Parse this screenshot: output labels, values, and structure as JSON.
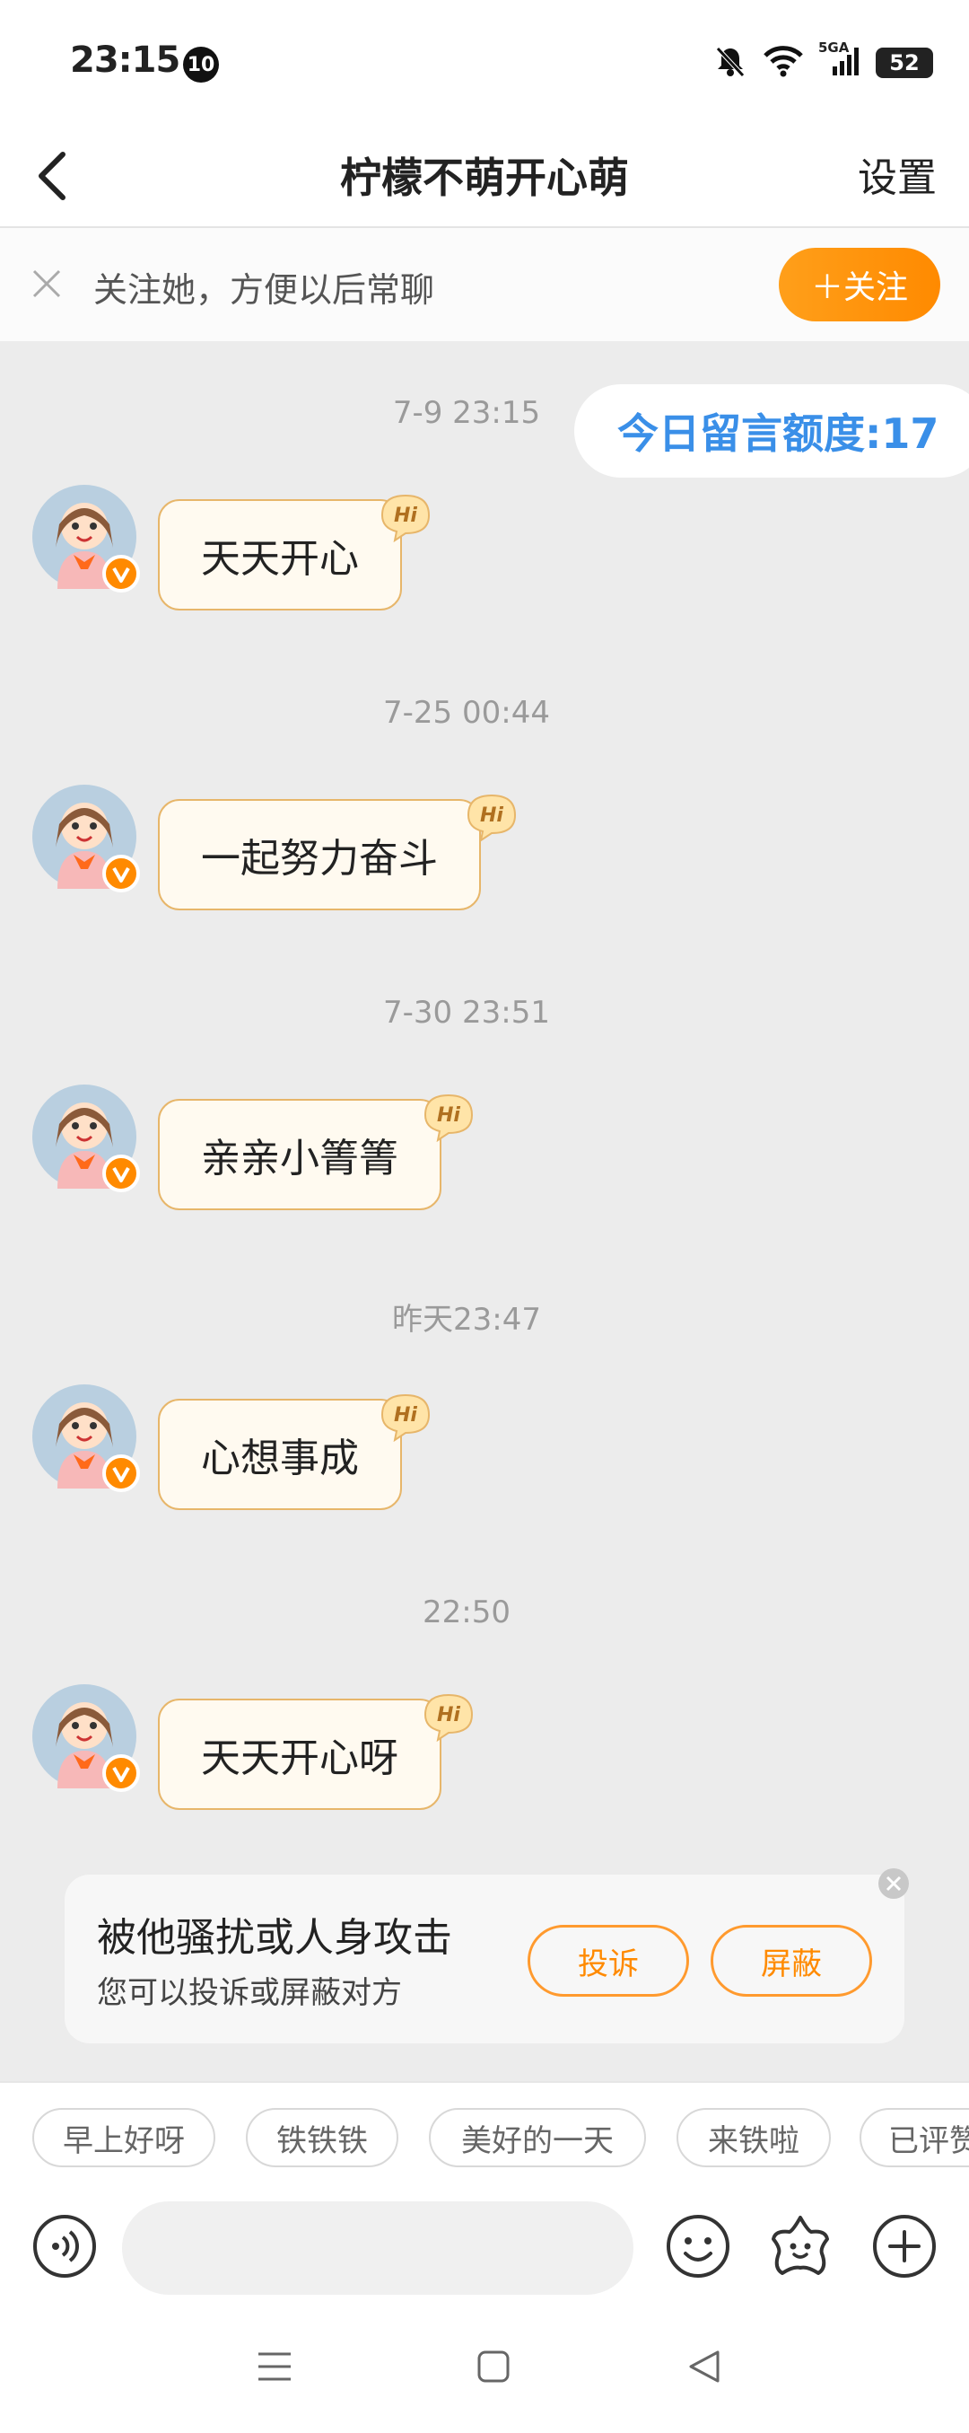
{
  "status_bar": {
    "time": "23:15",
    "notification_count": "10",
    "battery": "52",
    "network": "5GA"
  },
  "header": {
    "title": "柠檬不萌开心萌",
    "settings_label": "设置"
  },
  "follow_bar": {
    "text": "关注她，方便以后常聊",
    "button_label": "＋关注"
  },
  "quota": {
    "text": "今日留言额度:17"
  },
  "messages": [
    {
      "timestamp": "7-9 23:15",
      "text": "天天开心",
      "badge": "Hi"
    },
    {
      "timestamp": "7-25 00:44",
      "text": "一起努力奋斗",
      "badge": "Hi"
    },
    {
      "timestamp": "7-30 23:51",
      "text": "亲亲小箐箐",
      "badge": "Hi"
    },
    {
      "timestamp": "昨天23:47",
      "text": "心想事成",
      "badge": "Hi"
    },
    {
      "timestamp": "22:50",
      "text": "天天开心呀",
      "badge": "Hi"
    }
  ],
  "harassment_card": {
    "title": "被他骚扰或人身攻击",
    "subtitle": "您可以投诉或屏蔽对方",
    "report_label": "投诉",
    "block_label": "屏蔽"
  },
  "quick_replies": [
    "早上好呀",
    "铁铁铁",
    "美好的一天",
    "来铁啦",
    "已评赞"
  ],
  "input": {
    "placeholder": "",
    "value": ""
  },
  "colors": {
    "accent": "#ff8a00",
    "quota_text": "#3a8fe8",
    "bubble_border": "#e7b66a",
    "bubble_bg": "#fffaf0",
    "background": "#ececec"
  },
  "icons": [
    "back-arrow-icon",
    "close-icon",
    "voice-icon",
    "emoji-icon",
    "sticker-icon",
    "plus-icon",
    "verified-icon",
    "menu-nav-icon",
    "home-nav-icon",
    "back-nav-icon"
  ]
}
